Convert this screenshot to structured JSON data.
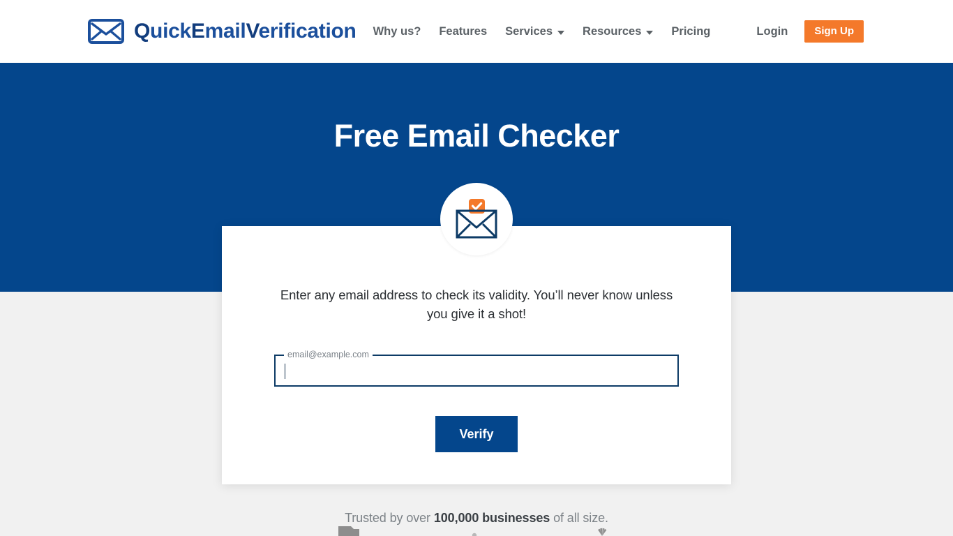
{
  "header": {
    "brand": {
      "icon": "envelope-icon",
      "text_part1": "Q",
      "text_full": "QuickEmailVerification"
    },
    "nav": [
      {
        "label": "Why us?",
        "has_caret": false
      },
      {
        "label": "Features",
        "has_caret": false
      },
      {
        "label": "Services",
        "has_caret": true
      },
      {
        "label": "Resources",
        "has_caret": true
      },
      {
        "label": "Pricing",
        "has_caret": false
      }
    ],
    "login_label": "Login",
    "signup_label": "Sign Up"
  },
  "hero": {
    "title": "Free Email Checker",
    "background_color": "#04468c"
  },
  "card": {
    "badge_icon": "email-verified-icon",
    "description": "Enter any email address to check its validity. You’ll never know unless you give it a shot!",
    "email_field": {
      "label": "email@example.com",
      "value": "",
      "placeholder": ""
    },
    "verify_label": "Verify"
  },
  "trusted": {
    "prefix": "Trusted by over ",
    "highlight": "100,000 businesses",
    "suffix": " of all size."
  },
  "colors": {
    "brand_blue": "#04468c",
    "accent_orange": "#f4792a",
    "page_bg": "#f1f1f1",
    "field_outline": "#0d3b66"
  }
}
